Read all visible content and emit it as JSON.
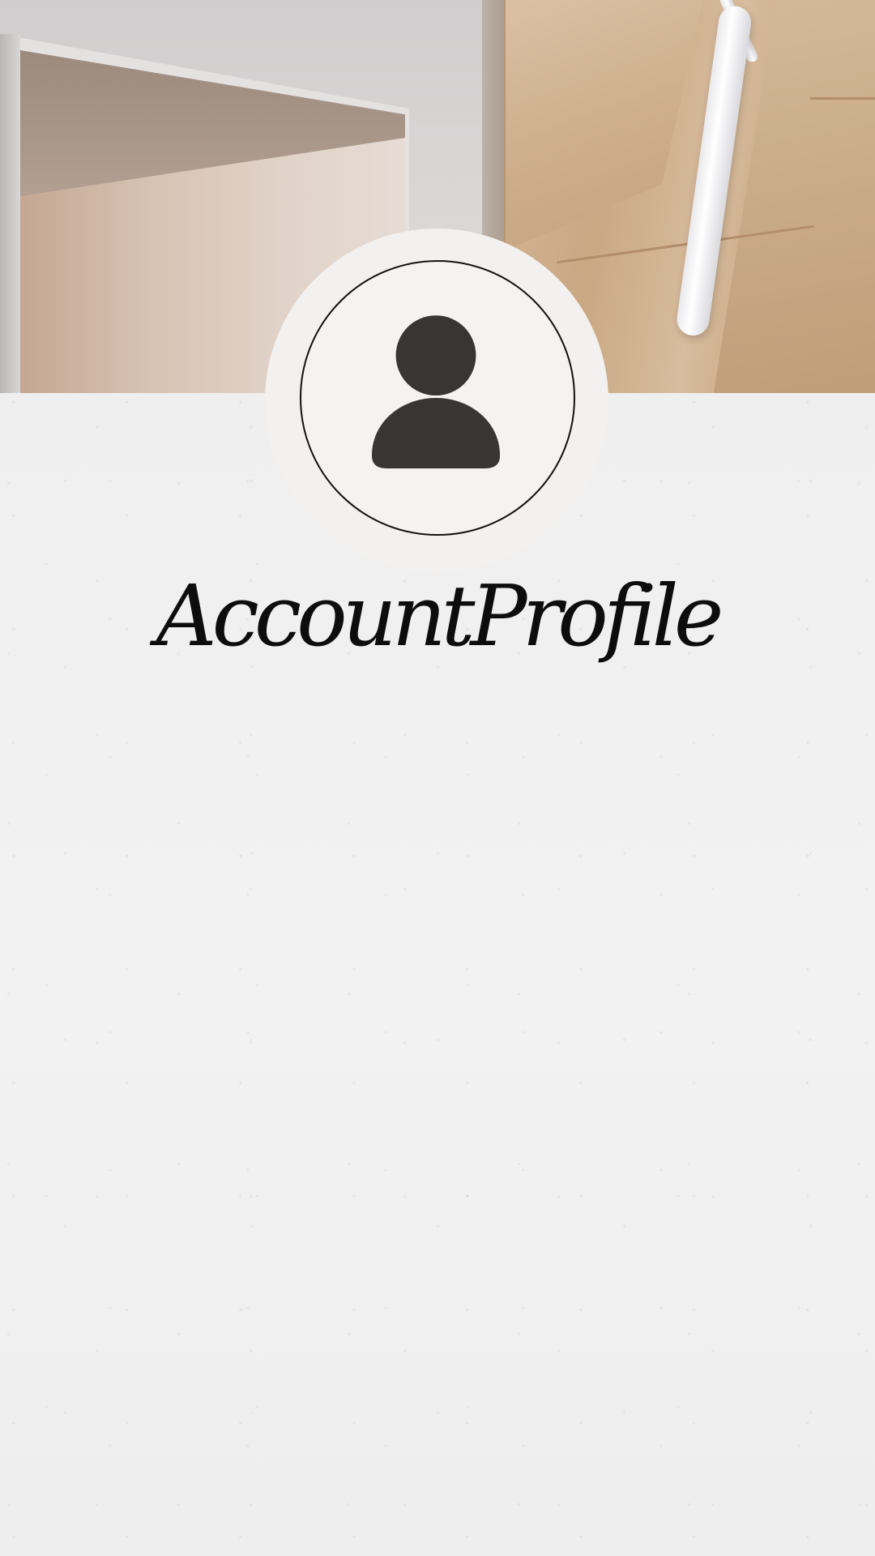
{
  "screen": {
    "background": "#f0f0f0"
  },
  "header": {
    "image_icon": "interior-photo"
  },
  "profile": {
    "avatar_icon": "user-silhouette-icon",
    "avatar_color": "#383535",
    "title": "AccountProfile"
  }
}
